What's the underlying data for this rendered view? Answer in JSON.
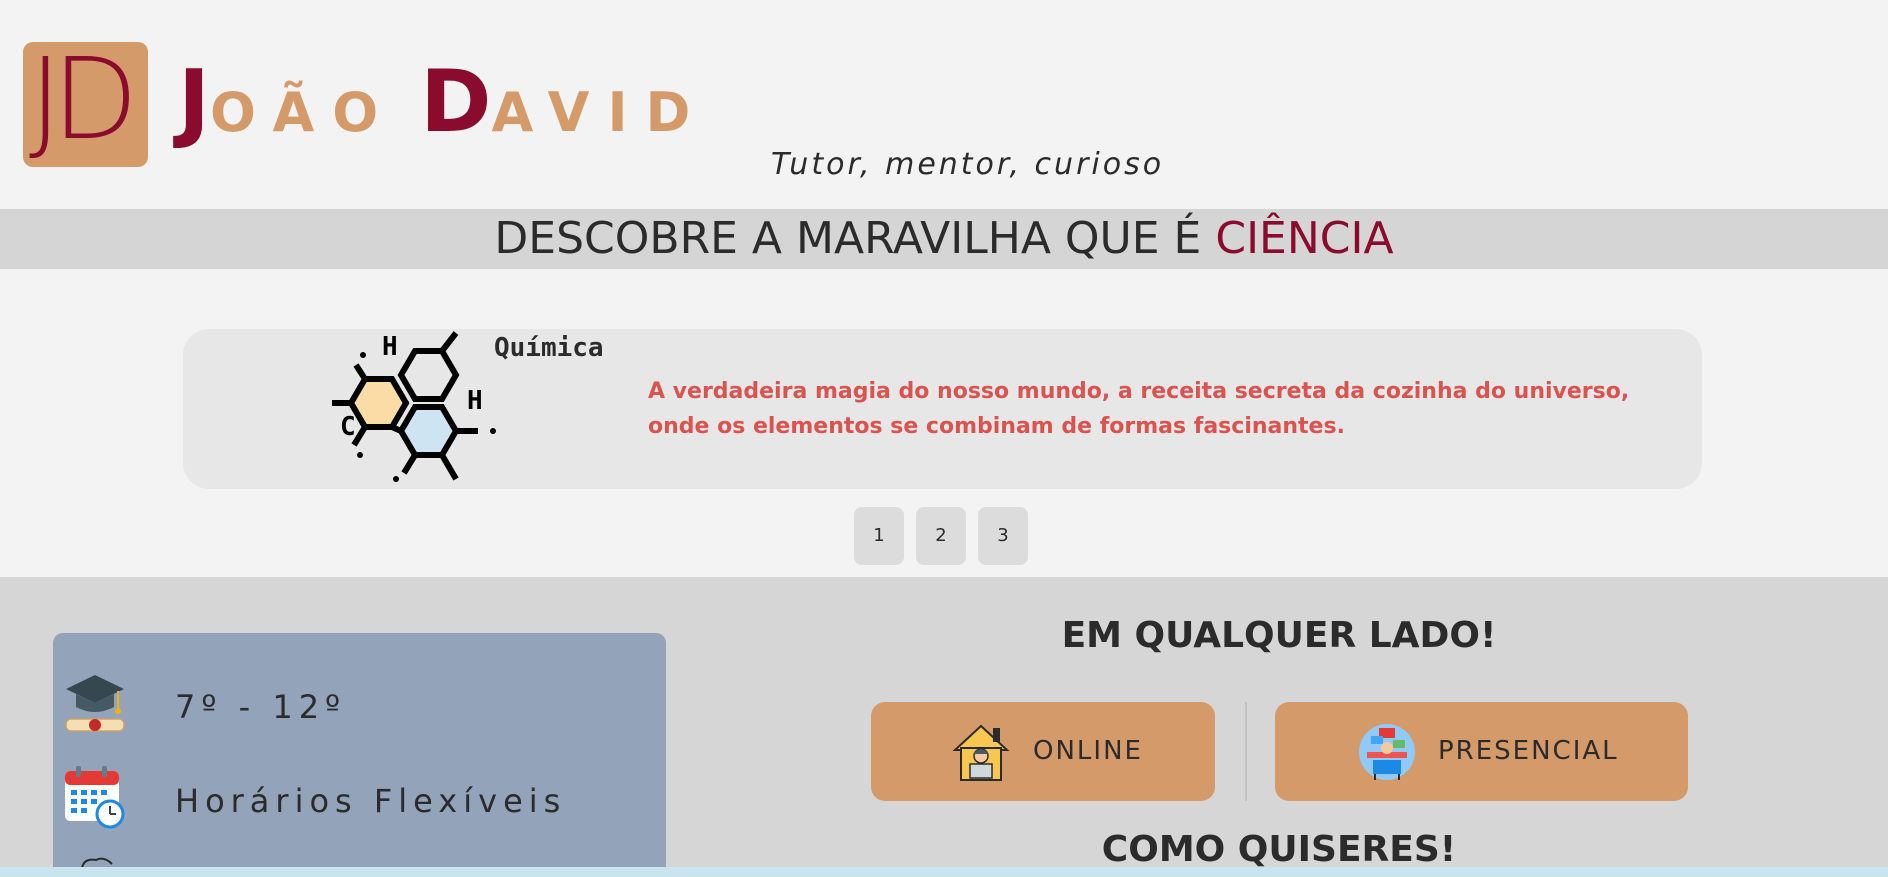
{
  "header": {
    "logo_text": "JD",
    "brand": {
      "first_initial": "J",
      "first_rest": "OÃO",
      "last_initial": "D",
      "last_rest": "AVID"
    },
    "tagline": "Tutor, mentor, curioso"
  },
  "banner": {
    "text": "DESCOBRE A MARAVILHA QUE É",
    "highlight": "CIÊNCIA"
  },
  "carousel": {
    "title": "Química",
    "description": "A verdadeira magia do nosso mundo, a receita secreta da cozinha do universo, onde os elementos se combinam de formas fascinantes.",
    "icon": "molecule-icon",
    "icon_labels": {
      "h_top": "H",
      "h_right": "H",
      "c_left": "C"
    },
    "pages": [
      "1",
      "2",
      "3"
    ]
  },
  "info": {
    "items": [
      {
        "icon": "graduation-cap-icon",
        "label": "7º - 12º"
      },
      {
        "icon": "calendar-clock-icon",
        "label": "Horários Flexíveis"
      }
    ]
  },
  "locations": {
    "heading": "EM QUALQUER LADO!",
    "online_label": "ONLINE",
    "presencial_label": "PRESENCIAL",
    "footer_heading": "COMO QUISERES!"
  },
  "colors": {
    "brand_dark": "#8b0b2e",
    "brand_light": "#d49a6a",
    "description_red": "#d9534f",
    "panel_blue": "#93a3b9"
  }
}
